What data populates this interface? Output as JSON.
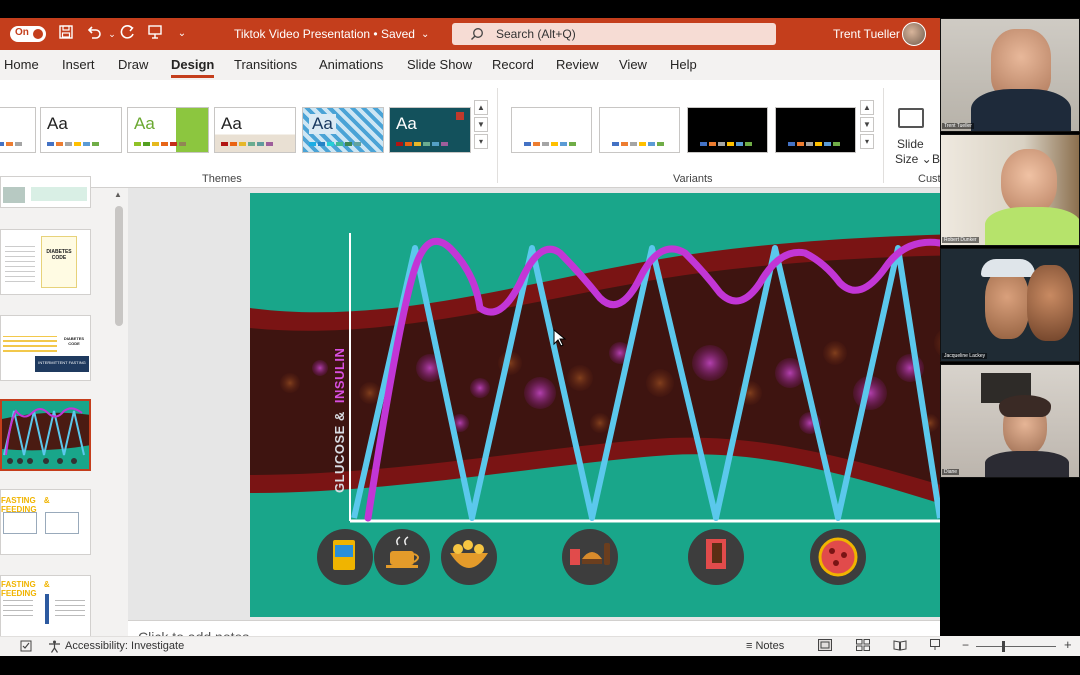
{
  "titlebar": {
    "autosave_state": "On",
    "document_title": "Tiktok Video Presentation • Saved",
    "search_placeholder": "Search (Alt+Q)",
    "user_name": "Trent Tueller"
  },
  "tabs": [
    {
      "label": "Home"
    },
    {
      "label": "Insert"
    },
    {
      "label": "Draw"
    },
    {
      "label": "Design"
    },
    {
      "label": "Transitions"
    },
    {
      "label": "Animations"
    },
    {
      "label": "Slide Show"
    },
    {
      "label": "Record"
    },
    {
      "label": "Review"
    },
    {
      "label": "View"
    },
    {
      "label": "Help"
    }
  ],
  "ribbon": {
    "themes_label": "Themes",
    "theme_sample": "Aa",
    "variants_label": "Variants",
    "slide_size_line1": "Slide",
    "slide_size_line2": "Size ⌄",
    "extra_b": "B",
    "customize_label": "Cust"
  },
  "slide": {
    "y_axis_text_part1": "GLUCOSE &",
    "y_axis_text_part2": "INSULIN",
    "food_icons": [
      "cereal-box-icon",
      "coffee-cup-icon",
      "chips-bowl-icon",
      "burger-fries-beer-icon",
      "chocolate-bar-icon",
      "pizza-icon"
    ],
    "glucose_color": "#5bc8ec",
    "insulin_color": "#c236d6"
  },
  "notes": {
    "placeholder": "Click to add notes"
  },
  "statusbar": {
    "accessibility": "Accessibility: Investigate",
    "notes_label": "Notes"
  },
  "participants": [
    {
      "name": "Trent Tueller"
    },
    {
      "name": "Robert Dunker"
    },
    {
      "name": "Jacqueline Lackey"
    },
    {
      "name": "Diane"
    }
  ],
  "thumbnails": [
    {
      "title": "DIABETES CODE"
    },
    {
      "title": "DIABETES CODE"
    },
    {
      "title": "INTERMITTENT FASTING"
    },
    {
      "title": ""
    },
    {
      "title_a": "FASTING",
      "title_b": "FEEDING"
    },
    {
      "title_a": "FASTING",
      "title_b": "FEEDING"
    }
  ],
  "colors": {
    "brand": "#c43e1c",
    "ribbon_bg": "#f3f2f1"
  }
}
